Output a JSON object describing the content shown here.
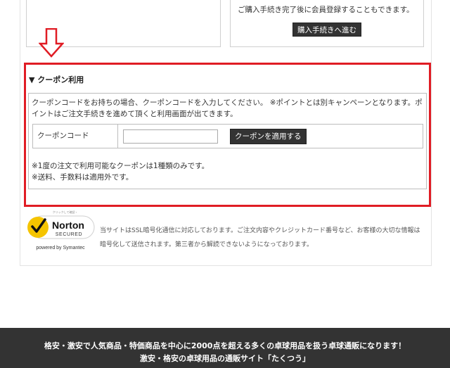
{
  "purchase": {
    "register_note": "ご購入手続き完了後に会員登録することもできます。",
    "proceed_button": "購入手続きへ進む"
  },
  "coupon": {
    "title": "▼ クーポン利用",
    "description": "クーポンコードをお持ちの場合、クーポンコードを入力してください。 ※ポイントとは別キャンペーンとなります。ポイントはご注文手続きを進めて頂くと利用画面が出てきます。",
    "code_label": "クーポンコード",
    "code_value": "",
    "apply_button": "クーポンを適用する",
    "notes": [
      "※1度の注文で利用可能なクーポンは1種類のみです。",
      "※送料、手数料は適用外です。"
    ]
  },
  "security": {
    "badge_top": "クリックして確認 ›",
    "badge_brand": "Norton",
    "badge_secured": "SECURED",
    "badge_powered": "powered by Symantec",
    "text": "当サイトはSSL暗号化通信に対応しております。ご注文内容やクレジットカード番号など、お客様の大切な情報は暗号化して送信されます。第三者から解読できないようになっております。"
  },
  "footer": {
    "line1": "格安・激安で人気商品・特価商品を中心に2000点を超える多くの卓球用品を扱う卓球通販になります！",
    "line2": "激安・格安の卓球用品の通販サイト「たくつう」"
  },
  "colors": {
    "highlight_red": "#e01c24",
    "button_dark": "#333333",
    "norton_yellow": "#f5c400",
    "footer_bg": "#333333"
  }
}
